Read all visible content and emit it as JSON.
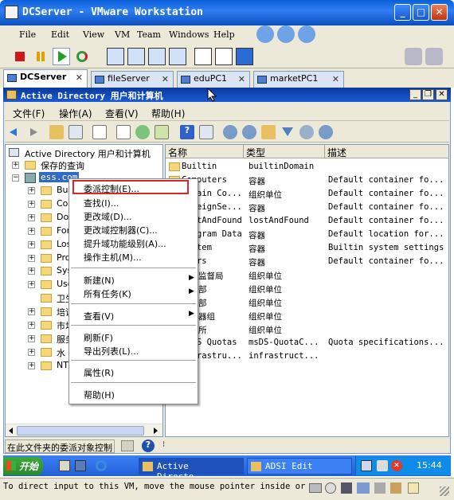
{
  "vm": {
    "title": "DCServer - VMware Workstation",
    "menu": [
      "File",
      "Edit",
      "View",
      "VM",
      "Team",
      "Windows",
      "Help"
    ],
    "tabs": [
      {
        "label": "DCServer",
        "active": true
      },
      {
        "label": "fileServer",
        "active": false
      },
      {
        "label": "eduPC1",
        "active": false
      },
      {
        "label": "marketPC1",
        "active": false
      }
    ],
    "status_text": "To direct input to this VM, move the mouse pointer inside or pr"
  },
  "guest": {
    "title": "Active Directory 用户和计算机",
    "menu": [
      "文件(F)",
      "操作(A)",
      "查看(V)",
      "帮助(H)"
    ],
    "tree": {
      "root": "Active Directory 用户和计算机",
      "saved_queries": "保存的查询",
      "domain": "ess.com",
      "children": [
        "Bui",
        "Com",
        "Dom",
        "For",
        "Los",
        "Pro",
        "Sys",
        "Use",
        "卫生",
        "培训",
        "市场",
        "服务",
        "水",
        "NTI"
      ]
    },
    "list": {
      "columns": [
        "名称",
        "类型",
        "描述"
      ],
      "rows": [
        [
          "Builtin",
          "builtinDomain",
          ""
        ],
        [
          "Computers",
          "容器",
          "Default container fo..."
        ],
        [
          "Domain Co...",
          "组织单位",
          "Default container fo..."
        ],
        [
          "ForeignSe...",
          "容器",
          "Default container fo..."
        ],
        [
          "LostAndFound",
          "lostAndFound",
          "Default container fo..."
        ],
        [
          "Program Data",
          "容器",
          "Default location for..."
        ],
        [
          "System",
          "容器",
          "Builtin system settings"
        ],
        [
          "Users",
          "容器",
          "Default container fo..."
        ],
        [
          "卫生监督局",
          "组织单位",
          ""
        ],
        [
          "培训部",
          "组织单位",
          ""
        ],
        [
          "市场部",
          "组织单位",
          ""
        ],
        [
          "服务器组",
          "组织单位",
          ""
        ],
        [
          "水务所",
          "组织单位",
          ""
        ],
        [
          "NTDS Quotas",
          "msDS-QuotaC...",
          "Quota specifications..."
        ],
        [
          "Infrastru...",
          "infrastruct...",
          ""
        ]
      ]
    },
    "status": "在此文件夹的委派对象控制"
  },
  "context_menu": {
    "items": [
      {
        "label": "委派控制(E)...",
        "highlighted": true
      },
      {
        "label": "查找(I)..."
      },
      {
        "label": "更改域(D)..."
      },
      {
        "label": "更改域控制器(C)..."
      },
      {
        "label": "提升域功能级别(A)..."
      },
      {
        "label": "操作主机(M)..."
      },
      {
        "label": "新建(N)",
        "submenu": true
      },
      {
        "label": "所有任务(K)",
        "submenu": true
      },
      {
        "label": "查看(V)",
        "submenu": true
      },
      {
        "label": "刷新(F)"
      },
      {
        "label": "导出列表(L)..."
      },
      {
        "label": "属性(R)"
      },
      {
        "label": "帮助(H)"
      }
    ]
  },
  "taskbar": {
    "start": "开始",
    "tasks": [
      "Active Directo...",
      "ADSI Edit"
    ],
    "clock": "15:44"
  },
  "colors": {
    "highlight_box": "#d8262a",
    "title_blue": "#0a5fd8",
    "taskbar": "#2360d8"
  }
}
